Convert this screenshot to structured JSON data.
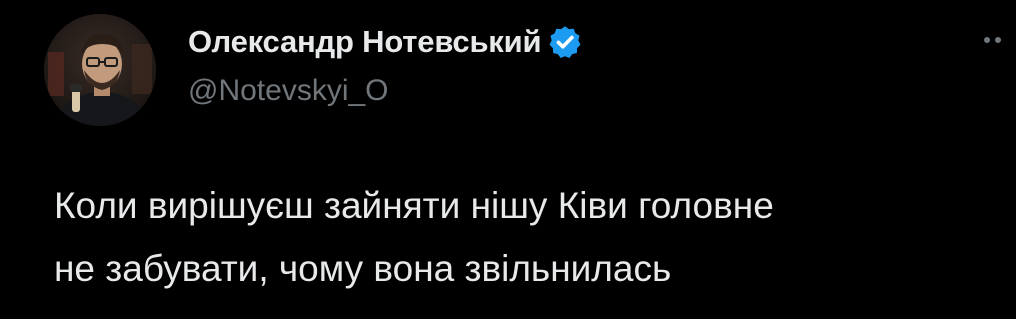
{
  "tweet": {
    "author": {
      "display_name": "Олександр Нотевський",
      "handle": "@Notevskyi_O",
      "verified": true,
      "verified_icon": "verified-badge-icon",
      "avatar_icon": "avatar-photo"
    },
    "more_icon": "more-options-icon",
    "text_lines": [
      "Коли вирішуєш зайняти нішу Ківи головне",
      "не забувати, чому вона звільнилась"
    ]
  },
  "colors": {
    "background": "#000000",
    "primary_text": "#e7e9ea",
    "secondary_text": "#71767b",
    "verified_blue": "#1d9bf0"
  }
}
